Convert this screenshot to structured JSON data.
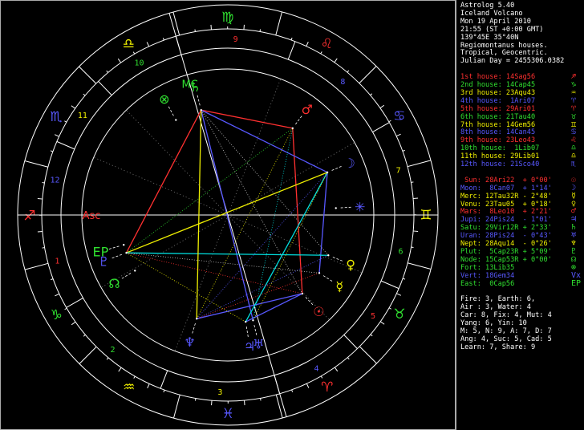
{
  "window": {
    "background": "#000000",
    "line_color": "#ffffff",
    "separator_color": "#aaaaaa"
  },
  "header": [
    "Astrolog 5.40",
    "Iceland Volcano",
    "Mon 19 April 2010",
    "21:55 (ST +0:00 GMT)",
    "139°45E 35°40N",
    "Regiomontanus houses.",
    "Tropical, Geocentric.",
    "Julian Day = 2455306.0382"
  ],
  "houses": [
    {
      "text": "1st house: 14Sag56",
      "color": "#ff3030",
      "glyph": "♐"
    },
    {
      "text": "2nd house: 14Cap45",
      "color": "#30e030",
      "glyph": "♑"
    },
    {
      "text": "3rd house: 23Aqu43",
      "color": "#f0f000",
      "glyph": "♒"
    },
    {
      "text": "4th house:  1Ari07",
      "color": "#5858ff",
      "glyph": "♈"
    },
    {
      "text": "5th house: 29Ari01",
      "color": "#ff3030",
      "glyph": "♈"
    },
    {
      "text": "6th house: 21Tau40",
      "color": "#30e030",
      "glyph": "♉"
    },
    {
      "text": "7th house: 14Gem56",
      "color": "#f0f000",
      "glyph": "♊"
    },
    {
      "text": "8th house: 14Can45",
      "color": "#5858ff",
      "glyph": "♋"
    },
    {
      "text": "9th house: 23Leo43",
      "color": "#ff3030",
      "glyph": "♌"
    },
    {
      "text": "10th house:  1Lib07",
      "color": "#30e030",
      "glyph": "♎"
    },
    {
      "text": "11th house: 29Lib01",
      "color": "#f0f000",
      "glyph": "♎"
    },
    {
      "text": "12th house: 21Sco40",
      "color": "#5858ff",
      "glyph": "♏"
    }
  ],
  "planets": [
    {
      "text": " Sun: 28Ari22  + 0°00'",
      "color": "#ff3030",
      "glyph": "☉"
    },
    {
      "text": "Moon:  8Can07  + 1°14'",
      "color": "#5858ff",
      "glyph": "☽"
    },
    {
      "text": "Merc: 12Tau32R - 2°48'",
      "color": "#f0f000",
      "glyph": "☿"
    },
    {
      "text": "Venu: 23Tau05  + 0°18'",
      "color": "#f0f000",
      "glyph": "♀"
    },
    {
      "text": "Mars:  8Leo10  + 2°21'",
      "color": "#ff3030",
      "glyph": "♂"
    },
    {
      "text": "Jupi: 24Pis24  - 1°01'",
      "color": "#5858ff",
      "glyph": "♃"
    },
    {
      "text": "Satu: 29Vir12R + 2°33'",
      "color": "#30e030",
      "glyph": "♄"
    },
    {
      "text": "Uran: 28Pis24  - 0°43'",
      "color": "#5858ff",
      "glyph": "♅"
    },
    {
      "text": "Nept: 28Aqu14  - 0°26'",
      "color": "#f0f000",
      "glyph": "♆"
    },
    {
      "text": "Plut:  5Cap23R + 5°09'",
      "color": "#30e030",
      "glyph": "♇"
    },
    {
      "text": "Node: 15Cap53R + 0°00'",
      "color": "#30e030",
      "glyph": "☊"
    },
    {
      "text": "Fort: 13Lib35",
      "color": "#30e030",
      "glyph": "⊗"
    },
    {
      "text": "Vert: 18Gem34",
      "color": "#5858ff",
      "glyph": "Vx"
    },
    {
      "text": "East:  0Cap56",
      "color": "#30e030",
      "glyph": "EP"
    }
  ],
  "stats": [
    "Fire: 3, Earth: 6,",
    "Air : 3, Water: 4",
    "Car: 8, Fix: 4, Mut: 4",
    "Yang: 6, Yin: 10",
    "M: 5, N: 9, A: 7, D: 7",
    "Ang: 4, Suc: 5, Cad: 5",
    "Learn: 7, Share: 9"
  ],
  "chart": {
    "asc_longitude": 254.93,
    "house_cusps": [
      254.93,
      284.75,
      323.72,
      1.12,
      29.02,
      51.67,
      74.93,
      104.75,
      143.72,
      181.12,
      209.02,
      231.67
    ],
    "house_numbers": [
      "1",
      "2",
      "3",
      "4",
      "5",
      "6",
      "7",
      "8",
      "9",
      "10",
      "11",
      "12"
    ],
    "sign_glyphs": [
      "♈",
      "♉",
      "♊",
      "♋",
      "♌",
      "♍",
      "♎",
      "♏",
      "♐",
      "♑",
      "♒",
      "♓"
    ],
    "sign_colors": [
      "#ff3030",
      "#30e030",
      "#f0f000",
      "#5858ff",
      "#ff3030",
      "#30e030",
      "#f0f000",
      "#5858ff",
      "#ff3030",
      "#30e030",
      "#f0f000",
      "#5858ff"
    ],
    "axis_labels": [
      {
        "label": "Asc",
        "longitude": 254.93,
        "color": "#ff3030"
      },
      {
        "label": "MC",
        "longitude": 181.12,
        "color": "#30e030"
      }
    ],
    "bodies": [
      {
        "name": "Sun",
        "glyph": "☉",
        "longitude": 28.37,
        "color": "#ff3030"
      },
      {
        "name": "Moon",
        "glyph": "☽",
        "longitude": 98.12,
        "color": "#5858ff"
      },
      {
        "name": "Mercury",
        "glyph": "☿",
        "longitude": 42.53,
        "color": "#f0f000"
      },
      {
        "name": "Venus",
        "glyph": "♀",
        "longitude": 53.08,
        "color": "#f0f000"
      },
      {
        "name": "Mars",
        "glyph": "♂",
        "longitude": 128.17,
        "color": "#ff3030"
      },
      {
        "name": "Jupiter",
        "glyph": "♃",
        "longitude": 354.4,
        "color": "#5858ff"
      },
      {
        "name": "Saturn",
        "glyph": "♄",
        "longitude": 179.2,
        "color": "#30e030"
      },
      {
        "name": "Uranus",
        "glyph": "♅",
        "longitude": 358.4,
        "color": "#5858ff"
      },
      {
        "name": "Neptune",
        "glyph": "♆",
        "longitude": 328.23,
        "color": "#5858ff"
      },
      {
        "name": "Pluto",
        "glyph": "♇",
        "longitude": 275.38,
        "color": "#5858ff"
      },
      {
        "name": "Node",
        "glyph": "☊",
        "longitude": 285.88,
        "color": "#30e030"
      },
      {
        "name": "Fortune",
        "glyph": "⊗",
        "longitude": 193.58,
        "color": "#30e030"
      },
      {
        "name": "Vertex",
        "glyph": "✳",
        "longitude": 78.57,
        "color": "#5858ff"
      },
      {
        "name": "East Point",
        "glyph": "EP",
        "longitude": 270.93,
        "color": "#30e030"
      }
    ],
    "aspects": [
      {
        "a": "Saturn",
        "b": "Mars",
        "color": "#ff3030",
        "style": "solid"
      },
      {
        "a": "Mars",
        "b": "Sun",
        "color": "#ff3030",
        "style": "solid"
      },
      {
        "a": "Saturn",
        "b": "Moon",
        "color": "#5858ff",
        "style": "solid"
      },
      {
        "a": "Moon",
        "b": "Mercury",
        "color": "#5858ff",
        "style": "solid"
      },
      {
        "a": "Saturn",
        "b": "Uranus",
        "color": "#5858ff",
        "style": "solid"
      },
      {
        "a": "Jupiter",
        "b": "Sun",
        "color": "#5858ff",
        "style": "solid"
      },
      {
        "a": "Sun",
        "b": "Neptune",
        "color": "#5858ff",
        "style": "solid"
      },
      {
        "a": "Saturn",
        "b": "Pluto",
        "color": "#ff3030",
        "style": "solid"
      },
      {
        "a": "Pluto",
        "b": "Moon",
        "color": "#f0f000",
        "style": "solid"
      },
      {
        "a": "Pluto",
        "b": "Venus",
        "color": "#00e0e0",
        "style": "solid"
      },
      {
        "a": "Moon",
        "b": "Jupiter",
        "color": "#00e0e0",
        "style": "solid"
      },
      {
        "a": "Saturn",
        "b": "Neptune",
        "color": "#f0f000",
        "style": "solid"
      },
      {
        "a": "Neptune",
        "b": "Mars",
        "color": "#f0f000",
        "style": "dotted"
      },
      {
        "a": "Pluto",
        "b": "Sun",
        "color": "#ff3030",
        "style": "dotted"
      },
      {
        "a": "Saturn",
        "b": "Sun",
        "color": "#c8c8c8",
        "style": "dotted"
      },
      {
        "a": "Mercury",
        "b": "Pluto",
        "color": "#c8c8c8",
        "style": "dotted"
      },
      {
        "a": "Mars",
        "b": "Uranus",
        "color": "#00e0e0",
        "style": "dotted"
      },
      {
        "a": "Venus",
        "b": "Neptune",
        "color": "#5858ff",
        "style": "dotted"
      },
      {
        "a": "Pluto",
        "b": "Mars",
        "color": "#30e030",
        "style": "dotted"
      },
      {
        "a": "Jupiter",
        "b": "Pluto",
        "color": "#f0f000",
        "style": "dotted"
      },
      {
        "a": "Saturn",
        "b": "Venus",
        "color": "#c8c8c8",
        "style": "dotted"
      },
      {
        "a": "Moon",
        "b": "Neptune",
        "color": "#5858ff",
        "style": "dotted"
      },
      {
        "a": "Uranus",
        "b": "Moon",
        "color": "#f0f000",
        "style": "dotted"
      },
      {
        "a": "Mercury",
        "b": "Neptune",
        "color": "#ff3030",
        "style": "dotted"
      }
    ]
  }
}
